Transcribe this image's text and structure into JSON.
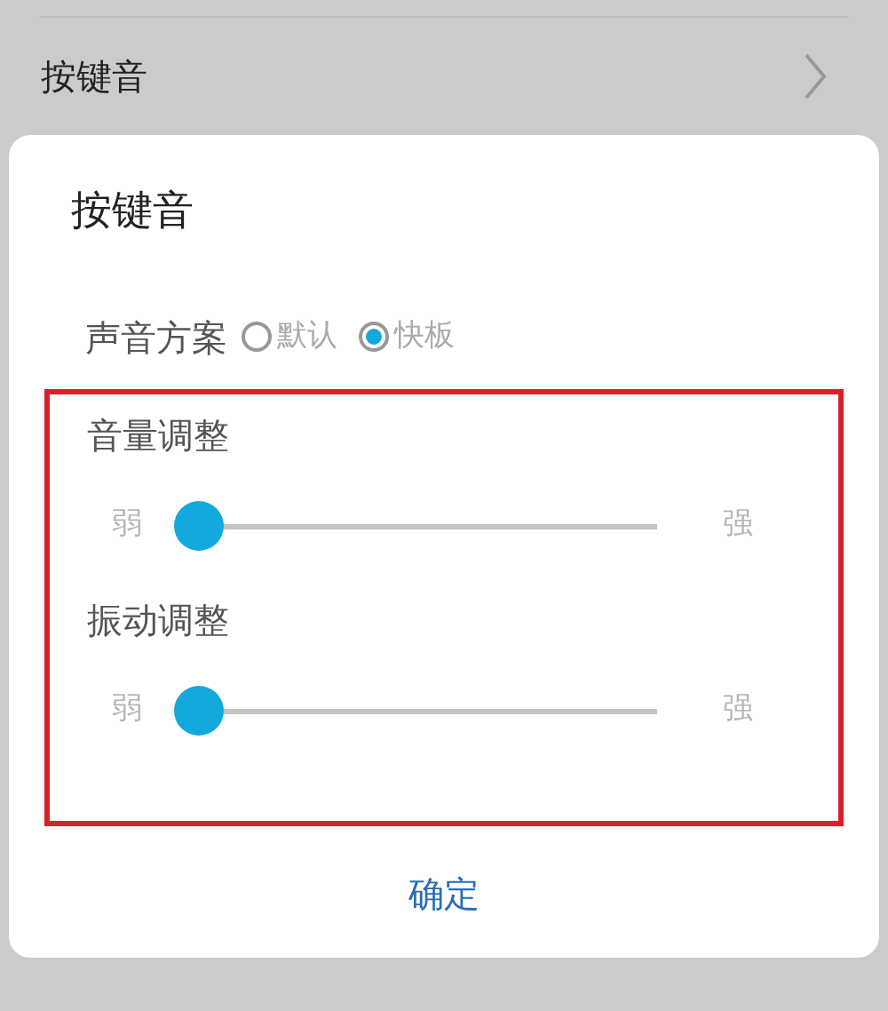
{
  "settings_row": {
    "label": "按键音"
  },
  "dialog": {
    "title": "按键音",
    "sound_scheme": {
      "label": "声音方案",
      "options": [
        {
          "label": "默认",
          "selected": false
        },
        {
          "label": "快板",
          "selected": true
        }
      ]
    },
    "sliders": [
      {
        "label": "音量调整",
        "min_label": "弱",
        "max_label": "强",
        "level": 0
      },
      {
        "label": "振动调整",
        "min_label": "弱",
        "max_label": "强",
        "level": 0
      }
    ],
    "confirm": "确定"
  }
}
